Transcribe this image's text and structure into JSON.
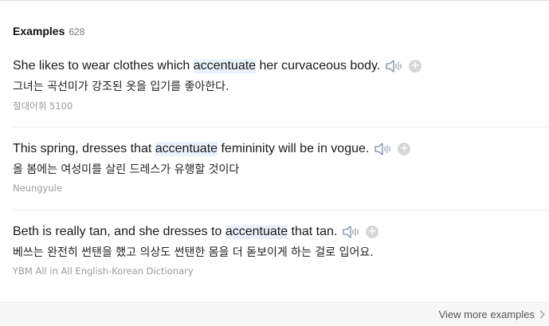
{
  "header": {
    "title": "Examples",
    "count": "628"
  },
  "examples": [
    {
      "en_before": "She likes to wear clothes which ",
      "en_highlight": "accentuate",
      "en_after": " her curvaceous body.",
      "ko": "그녀는 곡선미가 강조된 옷을 입기를 좋아한다.",
      "source": "절대어휘 5100"
    },
    {
      "en_before": "This spring, dresses that ",
      "en_highlight": "accentuate",
      "en_after": " femininity will be in vogue.",
      "ko": "올 봄에는 여성미를 살린 드레스가 유행할 것이다",
      "source": "Neungyule"
    },
    {
      "en_before": "Beth is really tan, and she dresses to ",
      "en_highlight": "accentuate",
      "en_after": " that tan.",
      "ko": "베쓰는 완전히 썬탠을 했고 의상도 썬탠한 몸을 더 돋보이게 하는 걸로 입어요.",
      "source": "YBM All in All English-Korean Dictionary"
    }
  ],
  "icons": {
    "speaker": "speaker-icon",
    "add": "plus-icon",
    "chevron": "chevron-right-icon"
  },
  "footer": {
    "view_more": "View more examples"
  },
  "colors": {
    "highlight": "#e9f2fd",
    "source_text": "#9a9a9a",
    "plus_bg": "#d6d6d6"
  }
}
